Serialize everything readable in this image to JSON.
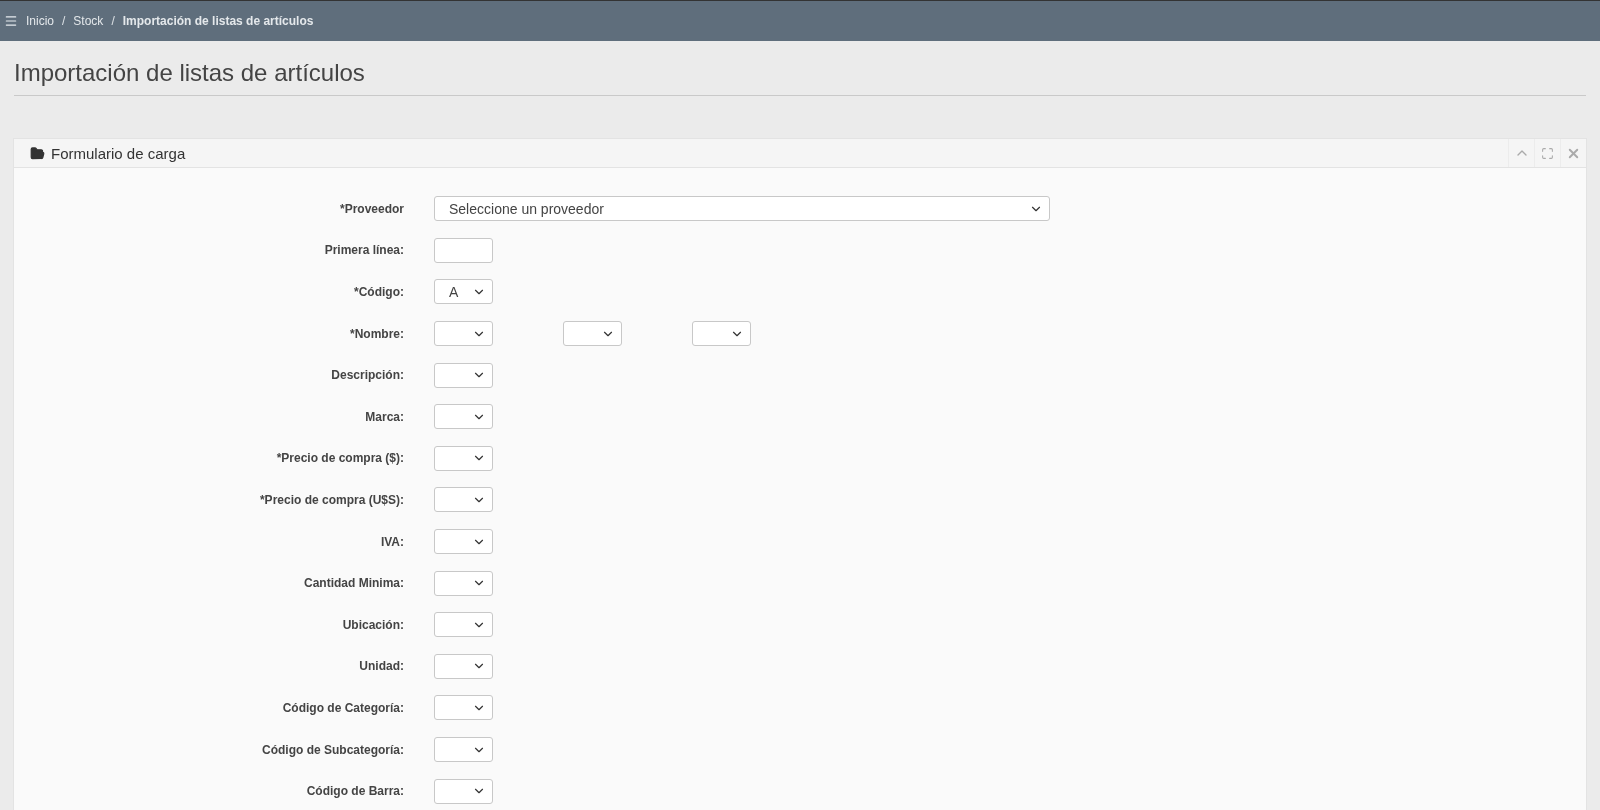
{
  "breadcrumb": [
    {
      "label": "Inicio",
      "current": false
    },
    {
      "label": "Stock",
      "current": false,
      "separator": "/"
    },
    {
      "label": "Importación de listas de artículos",
      "current": true,
      "separator": "/"
    }
  ],
  "page_title": "Importación de listas de artículos",
  "panel": {
    "title": "Formulario de carga",
    "fields": [
      {
        "label": "*Proveedor",
        "kind": "wide-select",
        "placeholder": "Seleccione un proveedor"
      },
      {
        "label": "Primera línea:",
        "kind": "input"
      },
      {
        "label": "*Código:",
        "kind": "selects",
        "selects": [
          {
            "kind": "dropdown",
            "value": "A"
          }
        ]
      },
      {
        "label": "*Nombre:",
        "kind": "selects",
        "selects": [
          {
            "kind": "dropdown"
          },
          {
            "kind": "dropdown"
          },
          {
            "kind": "dropdown"
          }
        ]
      },
      {
        "label": "Descripción:",
        "kind": "selects",
        "selects": [
          {
            "kind": "dropdown"
          }
        ]
      },
      {
        "label": "Marca:",
        "kind": "selects",
        "selects": [
          {
            "kind": "dropdown"
          }
        ]
      },
      {
        "label": "*Precio de compra ($):",
        "kind": "selects",
        "selects": [
          {
            "kind": "dropdown"
          }
        ]
      },
      {
        "label": "*Precio de compra (U$S):",
        "kind": "selects",
        "selects": [
          {
            "kind": "dropdown"
          }
        ]
      },
      {
        "label": "IVA:",
        "kind": "selects",
        "selects": [
          {
            "kind": "dropdown"
          }
        ]
      },
      {
        "label": "Cantidad Minima:",
        "kind": "selects",
        "selects": [
          {
            "kind": "dropdown"
          }
        ]
      },
      {
        "label": "Ubicación:",
        "kind": "selects",
        "selects": [
          {
            "kind": "dropdown"
          }
        ]
      },
      {
        "label": "Unidad:",
        "kind": "selects",
        "selects": [
          {
            "kind": "dropdown"
          }
        ]
      },
      {
        "label": "Código de Categoría:",
        "kind": "selects",
        "selects": [
          {
            "kind": "dropdown"
          }
        ]
      },
      {
        "label": "Código de Subcategoría:",
        "kind": "selects",
        "selects": [
          {
            "kind": "dropdown"
          }
        ]
      },
      {
        "label": "Código de Barra:",
        "kind": "selects",
        "selects": [
          {
            "kind": "dropdown"
          }
        ]
      }
    ]
  }
}
